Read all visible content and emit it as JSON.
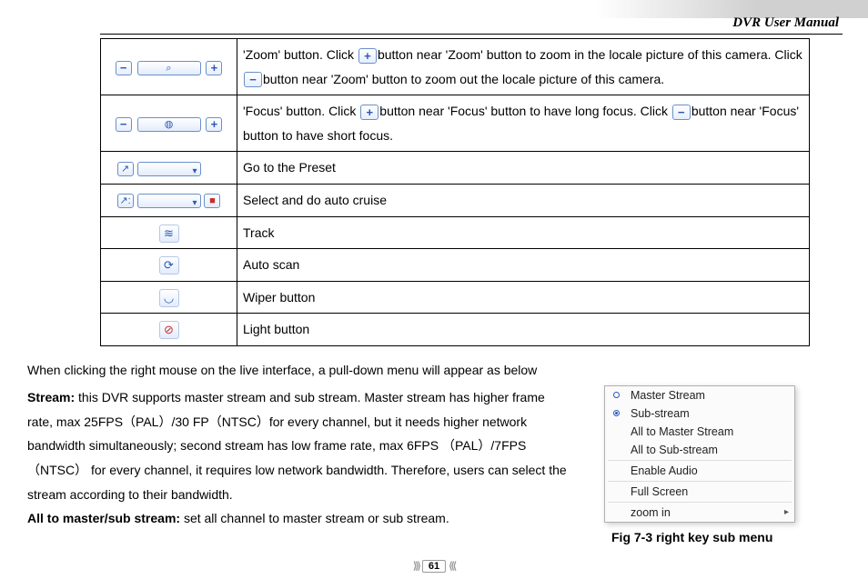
{
  "header": {
    "title": "DVR User Manual"
  },
  "table": {
    "rows": [
      {
        "desc_parts": [
          "'Zoom' button. Click ",
          "button near 'Zoom' button to zoom in the locale picture of this camera. Click ",
          "button near 'Zoom' button to zoom out the locale picture of this camera."
        ]
      },
      {
        "desc_parts": [
          "'Focus' button. Click ",
          "button near 'Focus' button to have long focus. Click ",
          "button near 'Focus' button to have short focus."
        ]
      },
      {
        "desc": "Go to the Preset"
      },
      {
        "desc": "Select and do auto cruise"
      },
      {
        "desc": "Track"
      },
      {
        "desc": "Auto scan"
      },
      {
        "desc": "Wiper button"
      },
      {
        "desc": "Light button"
      }
    ]
  },
  "paragraphs": {
    "intro": "When clicking the right mouse on the live interface, a pull-down menu will appear as below",
    "stream_label": "Stream:",
    "stream_body": " this DVR supports master stream and sub stream. Master stream has higher frame rate, max 25FPS（PAL）/30 FP（NTSC）for every channel, but it needs higher network bandwidth simultaneously; second stream has low frame rate, max 6FPS （PAL）/7FPS（NTSC） for every channel, it requires low network bandwidth. Therefore, users can select the stream according to their bandwidth.",
    "all_label": "All to master/sub stream:",
    "all_body": " set all channel to master stream or sub stream."
  },
  "popup": {
    "items": [
      {
        "label": "Master Stream",
        "radio": true,
        "selected": false
      },
      {
        "label": "Sub-stream",
        "radio": true,
        "selected": true
      },
      {
        "label": "All to Master Stream"
      },
      {
        "label": "All to Sub-stream"
      },
      {
        "label": "Enable Audio"
      },
      {
        "label": "Full Screen"
      },
      {
        "label": "zoom in",
        "submenu": true
      }
    ]
  },
  "figure_caption": "Fig 7-3 right key sub menu",
  "page_number": "61",
  "glyph": {
    "plus": "+",
    "minus": "−",
    "zoom": "⌕",
    "focus": "◍",
    "preset": "↗",
    "cruise": "↗:",
    "track": "≋",
    "autoscan": "⟳",
    "wiper": "◡",
    "light": "⊘",
    "stop": "■",
    "dot": "•"
  }
}
